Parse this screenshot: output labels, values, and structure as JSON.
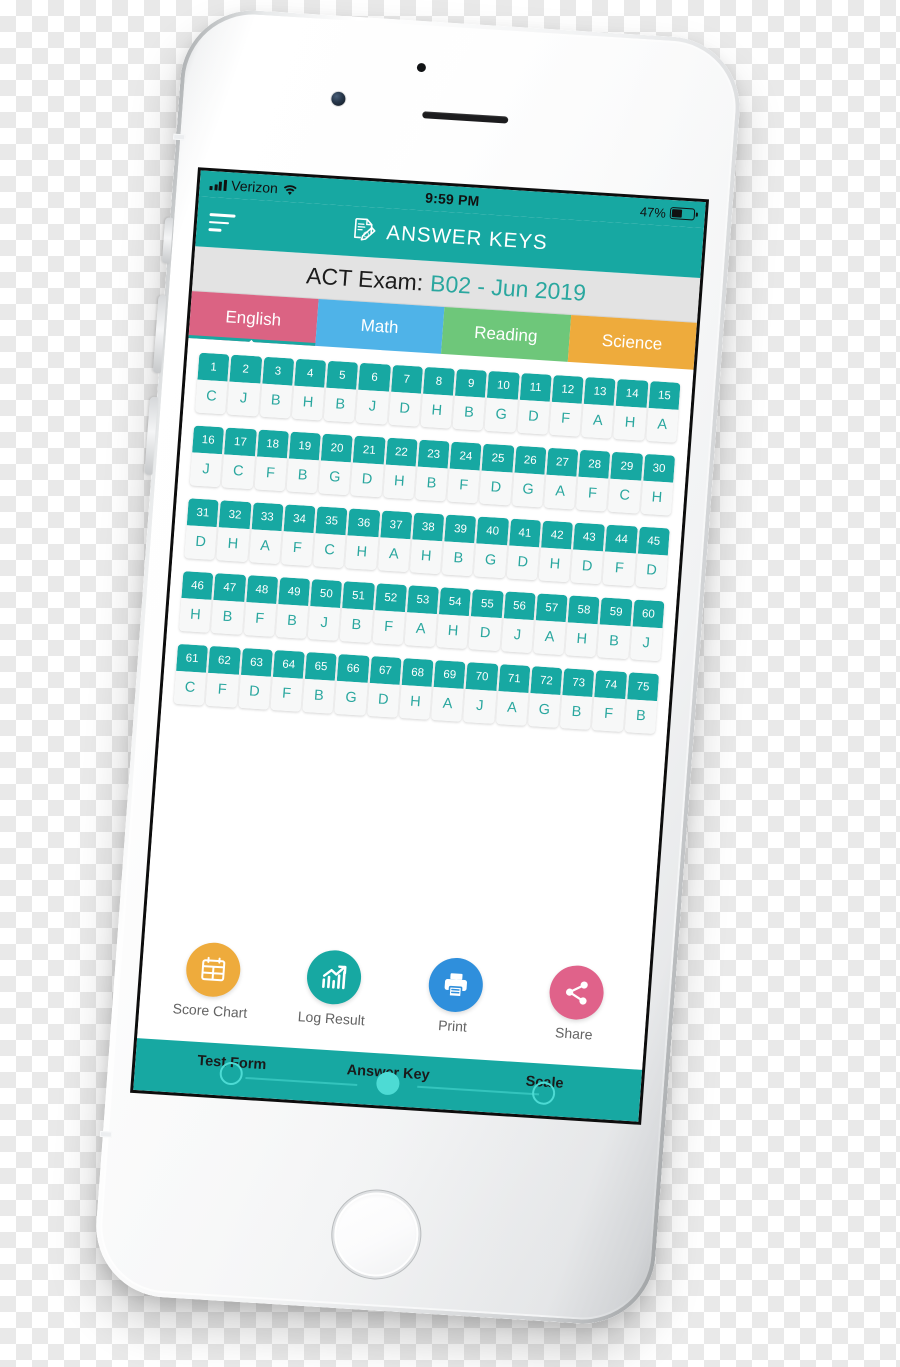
{
  "status_bar": {
    "carrier": "Verizon",
    "time": "9:59 PM",
    "battery_percent": "47%",
    "signal_icon": "signal-bars-icon",
    "wifi_icon": "wifi-icon",
    "battery_icon": "battery-icon"
  },
  "app_bar": {
    "menu_icon": "hamburger-menu-icon",
    "title_icon": "document-pen-icon",
    "title": "ANSWER KEYS"
  },
  "exam": {
    "label": "ACT Exam:",
    "value": "B02 - Jun 2019"
  },
  "tabs": [
    {
      "label": "English",
      "color": "#db6383",
      "active": true
    },
    {
      "label": "Math",
      "color": "#4fb3e8",
      "active": false
    },
    {
      "label": "Reading",
      "color": "#6ec77a",
      "active": false
    },
    {
      "label": "Science",
      "color": "#eeab3c",
      "active": false
    }
  ],
  "answer_key": {
    "section": "English",
    "rows": [
      {
        "numbers": [
          "1",
          "2",
          "3",
          "4",
          "5",
          "6",
          "7",
          "8",
          "9",
          "10",
          "11",
          "12",
          "13",
          "14",
          "15"
        ],
        "letters": [
          "C",
          "J",
          "B",
          "H",
          "B",
          "J",
          "D",
          "H",
          "B",
          "G",
          "D",
          "F",
          "A",
          "H",
          "A"
        ]
      },
      {
        "numbers": [
          "16",
          "17",
          "18",
          "19",
          "20",
          "21",
          "22",
          "23",
          "24",
          "25",
          "26",
          "27",
          "28",
          "29",
          "30"
        ],
        "letters": [
          "J",
          "C",
          "F",
          "B",
          "G",
          "D",
          "H",
          "B",
          "F",
          "D",
          "G",
          "A",
          "F",
          "C",
          "H"
        ]
      },
      {
        "numbers": [
          "31",
          "32",
          "33",
          "34",
          "35",
          "36",
          "37",
          "38",
          "39",
          "40",
          "41",
          "42",
          "43",
          "44",
          "45"
        ],
        "letters": [
          "D",
          "H",
          "A",
          "F",
          "C",
          "H",
          "A",
          "H",
          "B",
          "G",
          "D",
          "H",
          "D",
          "F",
          "D"
        ]
      },
      {
        "numbers": [
          "46",
          "47",
          "48",
          "49",
          "50",
          "51",
          "52",
          "53",
          "54",
          "55",
          "56",
          "57",
          "58",
          "59",
          "60"
        ],
        "letters": [
          "H",
          "B",
          "F",
          "B",
          "J",
          "B",
          "F",
          "A",
          "H",
          "D",
          "J",
          "A",
          "H",
          "B",
          "J"
        ]
      },
      {
        "numbers": [
          "61",
          "62",
          "63",
          "64",
          "65",
          "66",
          "67",
          "68",
          "69",
          "70",
          "71",
          "72",
          "73",
          "74",
          "75"
        ],
        "letters": [
          "C",
          "F",
          "D",
          "F",
          "B",
          "G",
          "D",
          "H",
          "A",
          "J",
          "A",
          "G",
          "B",
          "F",
          "B"
        ]
      }
    ]
  },
  "actions": [
    {
      "label": "Score Chart",
      "icon": "calendar-grid-icon",
      "color": "#eeab3c"
    },
    {
      "label": "Log Result",
      "icon": "chart-arrow-icon",
      "color": "#17a8a2"
    },
    {
      "label": "Print",
      "icon": "printer-icon",
      "color": "#2f8fdc"
    },
    {
      "label": "Share",
      "icon": "share-nodes-icon",
      "color": "#e0628a"
    }
  ],
  "stepper": {
    "steps": [
      {
        "label": "Test Form",
        "active": false
      },
      {
        "label": "Answer Key",
        "active": true
      },
      {
        "label": "Scale",
        "active": false
      }
    ]
  },
  "theme": {
    "teal": "#17a8a2",
    "teal_text": "#2aa79f",
    "accent_light": "#4ddbd4",
    "exam_bar_bg": "#e3e3e3"
  }
}
